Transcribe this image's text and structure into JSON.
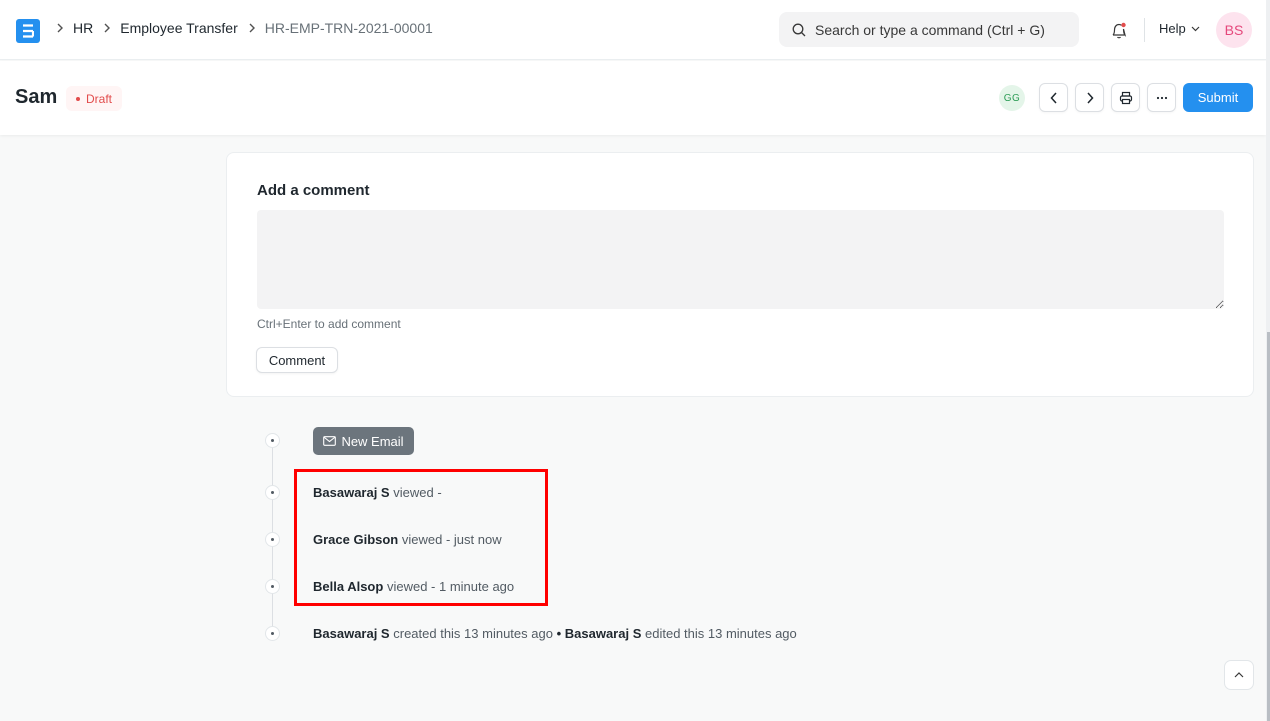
{
  "navbar": {
    "logo_letter": "E",
    "breadcrumbs": [
      "HR",
      "Employee Transfer",
      "HR-EMP-TRN-2021-00001"
    ],
    "search_placeholder": "Search or type a command (Ctrl + G)",
    "help_label": "Help",
    "user_initials": "BS",
    "notification_unread": true
  },
  "page_head": {
    "title": "Sam",
    "status": "Draft",
    "viewer_initials": "GG",
    "submit_label": "Submit"
  },
  "comment": {
    "title": "Add a comment",
    "placeholder": "",
    "hint": "Ctrl+Enter to add comment",
    "button_label": "Comment"
  },
  "timeline": {
    "new_email_label": "New Email",
    "views": [
      {
        "user": "Basawaraj S",
        "action": "viewed -"
      },
      {
        "user": "Grace Gibson",
        "action": "viewed - just now"
      },
      {
        "user": "Bella Alsop",
        "action": "viewed - 1 minute ago"
      }
    ],
    "created": {
      "user": "Basawaraj S",
      "action": "created this 13 minutes ago"
    },
    "separator": "•",
    "edited": {
      "user": "Basawaraj S",
      "action": "edited this 13 minutes ago"
    }
  },
  "colors": {
    "primary": "#2490ef",
    "draft": "#e24c4c",
    "highlight": "#ff0000"
  }
}
